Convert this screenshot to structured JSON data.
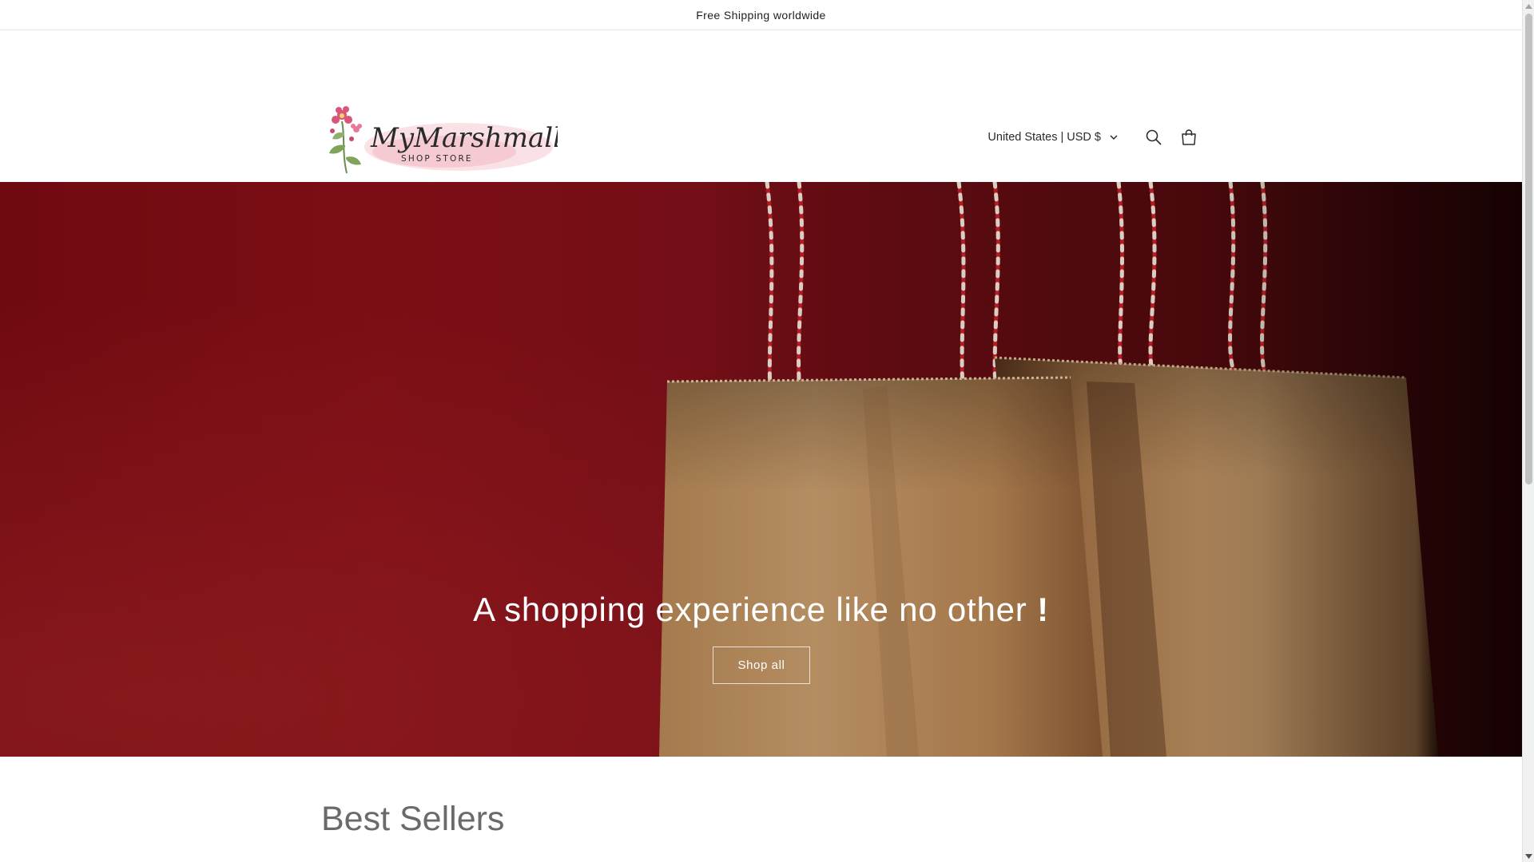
{
  "announcement": {
    "text": "Free Shipping worldwide"
  },
  "header": {
    "logo": {
      "script_text": "MyMarshmallow",
      "subtitle_text": "SHOP STORE"
    },
    "localization_label": "United States | USD $",
    "icons": {
      "search": "search-icon",
      "cart": "cart-icon",
      "chevron": "chevron-down-icon"
    }
  },
  "hero": {
    "title": "A shopping experience like no other",
    "exclamation": "!",
    "button_label": "Shop all"
  },
  "best_sellers": {
    "title": "Best Sellers"
  },
  "colors": {
    "hero_red": "#8a1018",
    "bag_kraft": "#c79a6a",
    "string_red": "#c8202a",
    "string_white": "#f1e6d8",
    "text_dark": "#121212",
    "heading_grey": "#6a6a6a",
    "logo_pink": "#f2b8c2"
  }
}
